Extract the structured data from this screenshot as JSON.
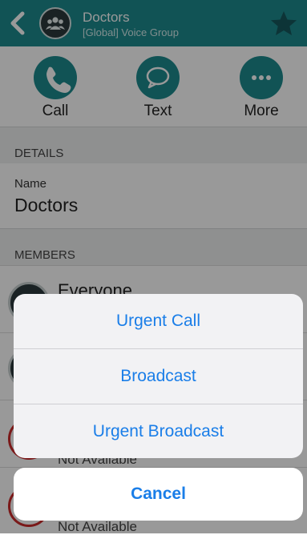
{
  "header": {
    "title": "Doctors",
    "subtitle": "[Global] Voice Group",
    "icons": {
      "back": "chevron-left-icon",
      "group": "group-icon",
      "favorite": "star-icon"
    }
  },
  "actions": [
    {
      "label": "Call",
      "icon": "phone-icon"
    },
    {
      "label": "Text",
      "icon": "chat-bubble-icon"
    },
    {
      "label": "More",
      "icon": "more-dots-icon"
    }
  ],
  "details": {
    "section_title": "DETAILS",
    "name_label": "Name",
    "name_value": "Doctors"
  },
  "members": {
    "section_title": "MEMBERS",
    "items": [
      {
        "name": "Everyone",
        "status": ""
      },
      {
        "name": "",
        "status": ""
      },
      {
        "name": "",
        "status": "Not Available"
      },
      {
        "name": "",
        "status": "Not Available"
      }
    ]
  },
  "action_sheet": {
    "options": [
      "Urgent Call",
      "Broadcast",
      "Urgent Broadcast"
    ],
    "cancel": "Cancel"
  },
  "colors": {
    "accent": "#1d8a8e",
    "ios_blue": "#1a7ee8",
    "unavailable": "#cc2a2a"
  }
}
